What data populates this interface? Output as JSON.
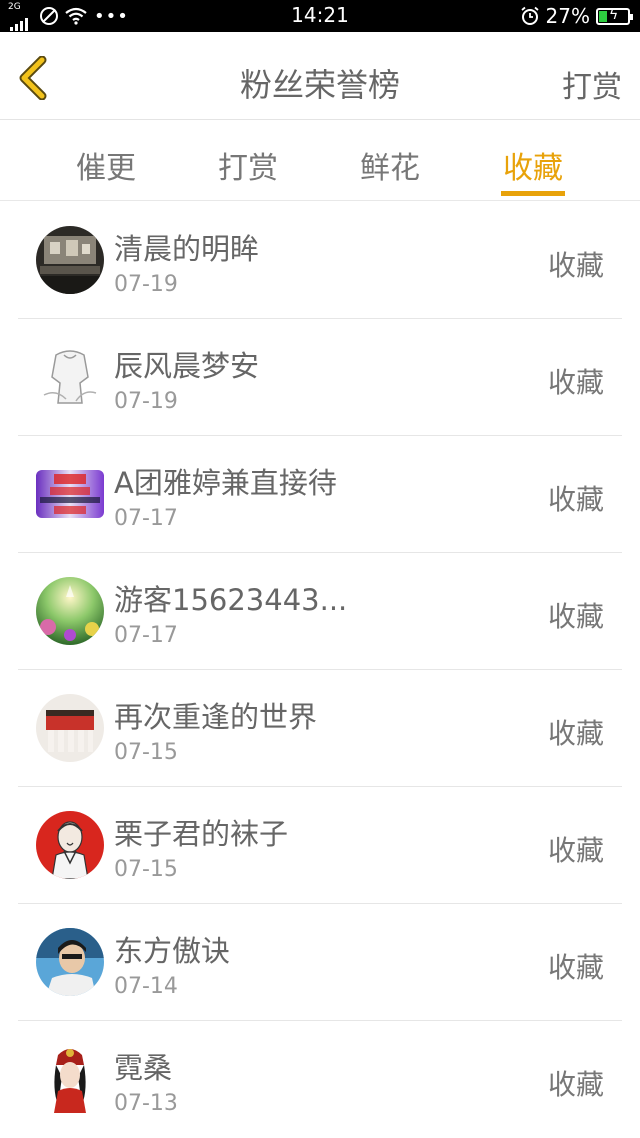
{
  "status_bar": {
    "network": "2G",
    "time": "14:21",
    "battery_percent": "27%",
    "battery_level": 0.27
  },
  "header": {
    "title": "粉丝荣誉榜",
    "right_action": "打赏",
    "back_icon": "chevron-left-icon"
  },
  "tabs": [
    {
      "label": "催更",
      "active": false
    },
    {
      "label": "打赏",
      "active": false
    },
    {
      "label": "鲜花",
      "active": false
    },
    {
      "label": "收藏",
      "active": true
    }
  ],
  "fans": [
    {
      "name": "清晨的明眸",
      "date": "07-19",
      "action": "收藏"
    },
    {
      "name": "辰风晨梦安",
      "date": "07-19",
      "action": "收藏"
    },
    {
      "name": "A团雅婷兼直接待",
      "date": "07-17",
      "action": "收藏"
    },
    {
      "name": "游客15623443...",
      "date": "07-17",
      "action": "收藏"
    },
    {
      "name": "再次重逢的世界",
      "date": "07-15",
      "action": "收藏"
    },
    {
      "name": "栗子君的袜子",
      "date": "07-15",
      "action": "收藏"
    },
    {
      "name": "东方傲诀",
      "date": "07-14",
      "action": "收藏"
    },
    {
      "name": "霓桑",
      "date": "07-13",
      "action": "收藏"
    }
  ],
  "colors": {
    "accent": "#e8a20a",
    "text": "#666666",
    "subtext": "#999999"
  }
}
